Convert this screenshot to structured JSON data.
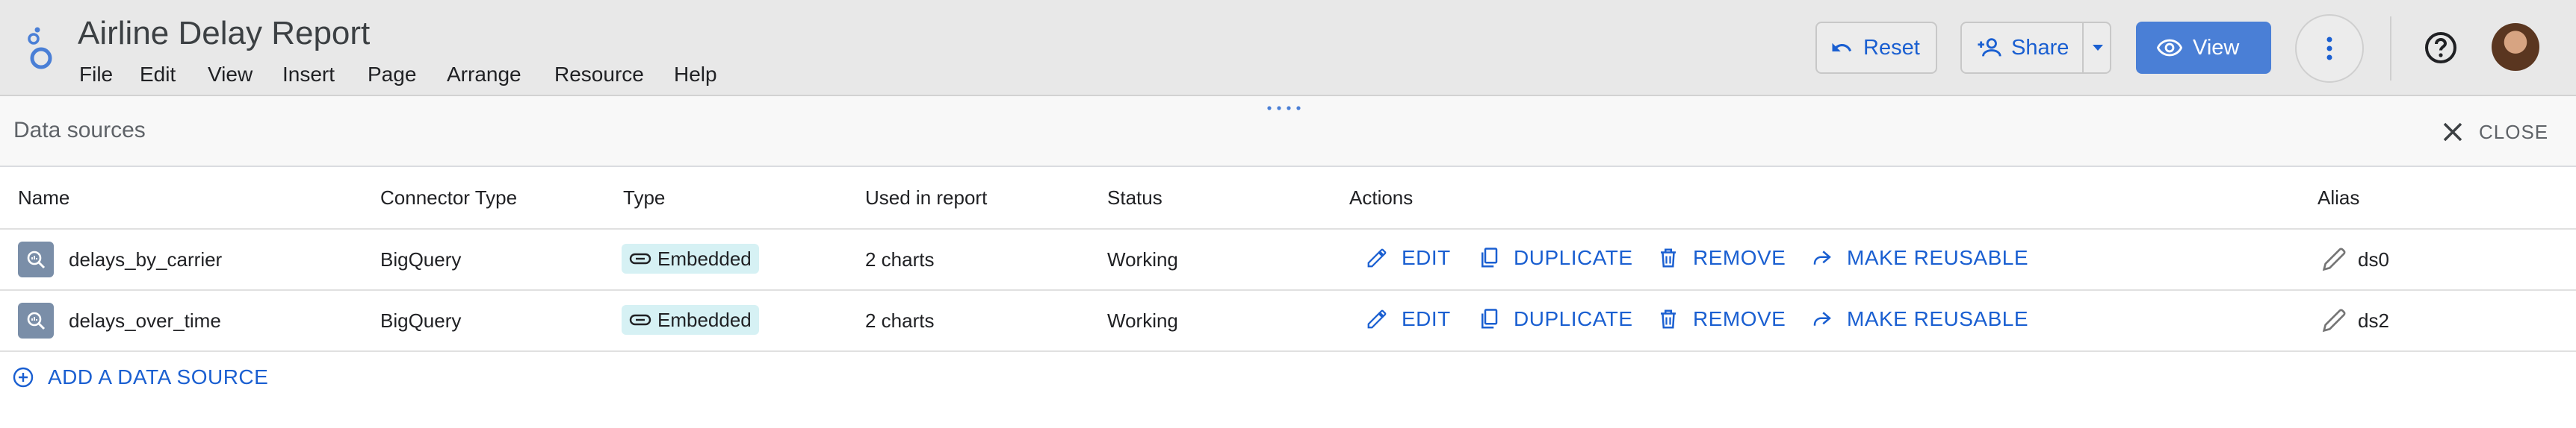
{
  "header": {
    "title": "Airline Delay Report",
    "menu": [
      "File",
      "Edit",
      "View",
      "Insert",
      "Page",
      "Arrange",
      "Resource",
      "Help"
    ],
    "reset_label": "Reset",
    "share_label": "Share",
    "view_label": "View"
  },
  "panel": {
    "title": "Data sources",
    "close_label": "CLOSE"
  },
  "table": {
    "columns": [
      "Name",
      "Connector Type",
      "Type",
      "Used in report",
      "Status",
      "Actions",
      "Alias"
    ],
    "actions": [
      "EDIT",
      "DUPLICATE",
      "REMOVE",
      "MAKE REUSABLE"
    ],
    "rows": [
      {
        "name": "delays_by_carrier",
        "connector": "BigQuery",
        "type": "Embedded",
        "used": "2 charts",
        "status": "Working",
        "alias": "ds0"
      },
      {
        "name": "delays_over_time",
        "connector": "BigQuery",
        "type": "Embedded",
        "used": "2 charts",
        "status": "Working",
        "alias": "ds2"
      }
    ]
  },
  "add_data_source_label": "ADD A DATA SOURCE",
  "colors": {
    "accent": "#1a5fd1",
    "header_bg": "#e8e8e8",
    "view_button": "#4a7fd6",
    "badge_bg": "#d6f1f4",
    "datasource_icon": "#7a8ea8"
  },
  "icons": {
    "logo": "looker-studio-logo-icon",
    "reset": "undo-icon",
    "share": "person-add-icon",
    "view": "eye-icon",
    "more": "more-vert-icon",
    "help": "help-circle-icon",
    "close": "close-icon",
    "datasource": "bigquery-icon",
    "embedded": "link-icon",
    "edit": "pencil-icon",
    "duplicate": "copy-icon",
    "remove": "trash-icon",
    "make_reusable": "share-arrow-icon",
    "alias": "pencil-icon",
    "add": "add-circle-icon"
  }
}
